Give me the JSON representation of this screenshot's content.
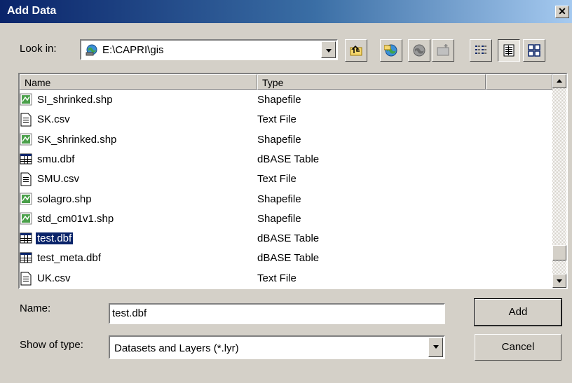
{
  "window": {
    "title": "Add Data"
  },
  "look_in": {
    "label": "Look in:",
    "path": "E:\\CAPRI\\gis"
  },
  "toolbar": {
    "buttons": [
      "up-one-level",
      "connect-to-folder",
      "disconnect-from-folder",
      "new-folder",
      "list-view",
      "details-view",
      "thumbnails-view"
    ]
  },
  "file_list": {
    "columns": [
      "Name",
      "Type"
    ],
    "rows": [
      {
        "name": "SI_shrinked.shp",
        "type": "Shapefile",
        "icon": "shapefile-icon"
      },
      {
        "name": "SK.csv",
        "type": "Text File",
        "icon": "text-file-icon"
      },
      {
        "name": "SK_shrinked.shp",
        "type": "Shapefile",
        "icon": "shapefile-icon"
      },
      {
        "name": "smu.dbf",
        "type": "dBASE Table",
        "icon": "dbase-table-icon"
      },
      {
        "name": "SMU.csv",
        "type": "Text File",
        "icon": "text-file-icon"
      },
      {
        "name": "solagro.shp",
        "type": "Shapefile",
        "icon": "shapefile-icon"
      },
      {
        "name": "std_cm01v1.shp",
        "type": "Shapefile",
        "icon": "shapefile-icon"
      },
      {
        "name": "test.dbf",
        "type": "dBASE Table",
        "icon": "dbase-table-icon",
        "selected": true
      },
      {
        "name": "test_meta.dbf",
        "type": "dBASE Table",
        "icon": "dbase-table-icon"
      },
      {
        "name": "UK.csv",
        "type": "Text File",
        "icon": "text-file-icon"
      }
    ]
  },
  "name_field": {
    "label": "Name:",
    "value": "test.dbf"
  },
  "type_field": {
    "label": "Show of type:",
    "value": "Datasets and Layers (*.lyr)"
  },
  "buttons": {
    "add": "Add",
    "cancel": "Cancel"
  },
  "colors": {
    "title_start": "#0a246a",
    "title_end": "#a6caf0",
    "selection": "#0a246a",
    "face": "#d4d0c8"
  }
}
